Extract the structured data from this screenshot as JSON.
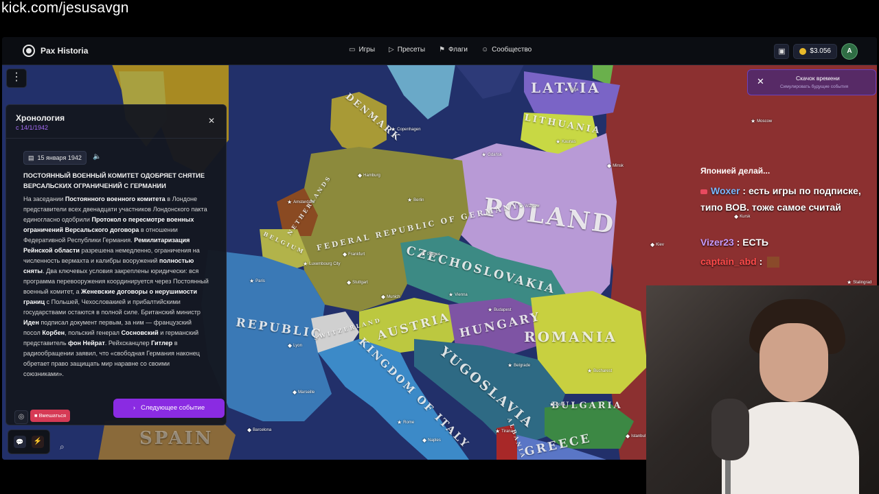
{
  "stream": {
    "url": "kick.com/jesusavgn"
  },
  "app": {
    "brand": "Pax Historia",
    "nav": [
      {
        "icon": "gamepad-icon",
        "label": "Игры"
      },
      {
        "icon": "play-icon",
        "label": "Пресеты"
      },
      {
        "icon": "flag-icon",
        "label": "Флаги"
      },
      {
        "icon": "users-icon",
        "label": "Сообщество"
      }
    ],
    "balance": "$3.056",
    "avatar_initial": "A"
  },
  "timeline": {
    "title": "Хронология",
    "subtitle": "с 14/1/1942",
    "date": "15 января 1942",
    "headline": "ПОСТОЯННЫЙ ВОЕННЫЙ КОМИТЕТ ОДОБРЯЕТ СНЯТИЕ ВЕРСАЛЬСКИХ ОГРАНИЧЕНИЙ С ГЕРМАНИИ",
    "body_segments": [
      {
        "t": "На заседании ",
        "b": false
      },
      {
        "t": "Постоянного военного комитета",
        "b": true
      },
      {
        "t": " в Лондоне представители всех двенадцати участников Лондонского пакта единогласно одобрили ",
        "b": false
      },
      {
        "t": "Протокол о пересмотре военных ограничений Версальского договора",
        "b": true
      },
      {
        "t": " в отношении Федеративной Республики Германия. ",
        "b": false
      },
      {
        "t": "Ремилитаризация Рейнской области",
        "b": true
      },
      {
        "t": " разрешена немедленно, ограничения на численность вермахта и калибры вооружений ",
        "b": false
      },
      {
        "t": "полностью сняты",
        "b": true
      },
      {
        "t": ". Два ключевых условия закреплены юридически: вся программа перевооружения координируется через Постоянный военный комитет, а ",
        "b": false
      },
      {
        "t": "Женевские договоры о нерушимости границ",
        "b": true
      },
      {
        "t": " с Польшей, Чехословакией и прибалтийскими государствами остаются в полной силе. Британский министр ",
        "b": false
      },
      {
        "t": "Иден",
        "b": true
      },
      {
        "t": " подписал документ первым, за ним — французский посол ",
        "b": false
      },
      {
        "t": "Корбен",
        "b": true
      },
      {
        "t": ", польский генерал ",
        "b": false
      },
      {
        "t": "Сосновский",
        "b": true
      },
      {
        "t": " и германский представитель ",
        "b": false
      },
      {
        "t": "фон Нейрат",
        "b": true
      },
      {
        "t": ". Рейхсканцлер ",
        "b": false
      },
      {
        "t": "Гитлер",
        "b": true
      },
      {
        "t": " в радиообращении заявил, что «свободная Германия наконец обретает право защищать мир наравне со своими союзниками».",
        "b": false
      }
    ],
    "interfere_label": "Вмешаться",
    "next_label": "Следующее событие"
  },
  "time_skip": {
    "title": "Скачок времени",
    "subtitle": "Симулировать будущие события"
  },
  "map": {
    "country_labels": [
      {
        "text": "LATVIA"
      },
      {
        "text": "LITHUANIA"
      },
      {
        "text": "DENMARK"
      },
      {
        "text": "POLAND"
      },
      {
        "text": "FEDERAL REPUBLIC OF GERMANY"
      },
      {
        "text": "NETHERLANDS"
      },
      {
        "text": "BELGIUM"
      },
      {
        "text": "CZECHOSLOVAKIA"
      },
      {
        "text": "AUSTRIA"
      },
      {
        "text": "HUNGARY"
      },
      {
        "text": "ROMANIA"
      },
      {
        "text": "YUGOSLAVIA"
      },
      {
        "text": "REPUBLIC"
      },
      {
        "text": "SWITZERLAND"
      },
      {
        "text": "KINGDOM OF ITALY"
      },
      {
        "text": "BULGARIA"
      },
      {
        "text": "GREECE"
      },
      {
        "text": "ALBANIA"
      },
      {
        "text": "SPAIN"
      }
    ],
    "cities": [
      "Riga",
      "Kaunas",
      "Moscow",
      "Copenhagen",
      "Gdańsk",
      "Minsk",
      "Hamburg",
      "Berlin",
      "Warsaw",
      "Amsterdam",
      "Luxembourg City",
      "Frankfurt",
      "Kiev",
      "Paris",
      "Prague",
      "Stuttgart",
      "Munich",
      "Vienna",
      "Budapest",
      "Lyon",
      "Belgrade",
      "Bucharest",
      "Marseille",
      "Barcelona",
      "Rome",
      "Sofia",
      "Tirana",
      "Naples",
      "Istanbul",
      "Stalingrad",
      "Kursk"
    ]
  },
  "chat": {
    "fragment": "Японией делай...",
    "messages": [
      {
        "user": "Woxer",
        "user_color": "#7ab8ff",
        "text": " : есть игры по подписке, типо ВОВ. тоже самое считай"
      },
      {
        "user": "Vizer23",
        "user_color": "#c79cff",
        "text": " : ЕСТЬ"
      },
      {
        "user": "captain_abd",
        "user_color": "#ff4a4a",
        "text": " :"
      }
    ]
  }
}
